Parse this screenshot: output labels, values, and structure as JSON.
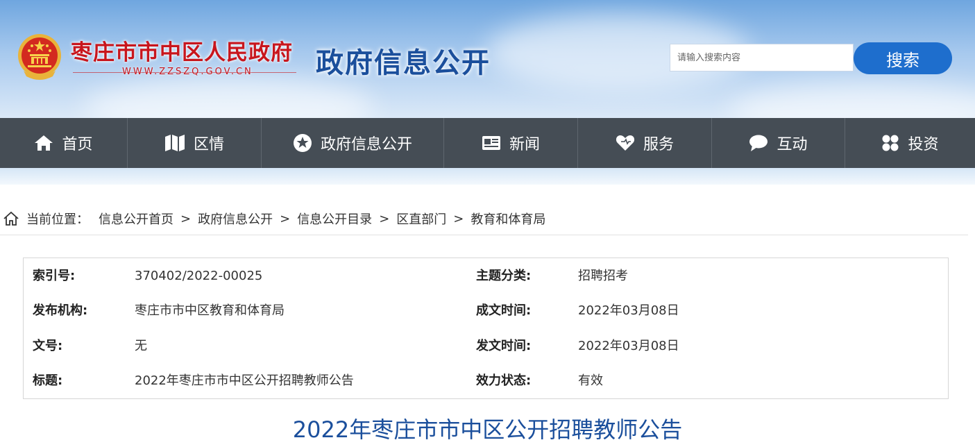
{
  "header": {
    "site_name": "枣庄市市中区人民政府",
    "site_url": "WWW.ZZSZQ.GOV.CN",
    "section_title": "政府信息公开",
    "search_placeholder": "请输入搜索内容",
    "search_button": "搜索"
  },
  "nav": {
    "items": [
      {
        "label": "首页",
        "icon": "home-icon"
      },
      {
        "label": "区情",
        "icon": "map-icon"
      },
      {
        "label": "政府信息公开",
        "icon": "star-circle-icon"
      },
      {
        "label": "新闻",
        "icon": "id-card-icon"
      },
      {
        "label": "服务",
        "icon": "heart-icon"
      },
      {
        "label": "互动",
        "icon": "chat-bubble-icon"
      },
      {
        "label": "投资",
        "icon": "grid-dots-icon"
      }
    ]
  },
  "breadcrumb": {
    "prefix": "当前位置：",
    "separator": ">",
    "items": [
      "信息公开首页",
      "政府信息公开",
      "信息公开目录",
      "区直部门",
      "教育和体育局"
    ]
  },
  "info": {
    "index_label": "索引号:",
    "index_value": "370402/2022-00025",
    "topic_label": "主题分类:",
    "topic_value": "招聘招考",
    "publisher_label": "发布机构:",
    "publisher_value": "枣庄市市中区教育和体育局",
    "created_label": "成文时间:",
    "created_value": "2022年03月08日",
    "doc_no_label": "文号:",
    "doc_no_value": "无",
    "issued_label": "发文时间:",
    "issued_value": "2022年03月08日",
    "title_label": "标题:",
    "title_value": "2022年枣庄市市中区公开招聘教师公告",
    "status_label": "效力状态:",
    "status_value": "有效"
  },
  "article": {
    "title": "2022年枣庄市市中区公开招聘教师公告"
  },
  "colors": {
    "nav_bg": "#454d55",
    "brand_red": "#c8161d",
    "brand_blue": "#1b4f9c",
    "button_blue": "#1e6ecd"
  }
}
